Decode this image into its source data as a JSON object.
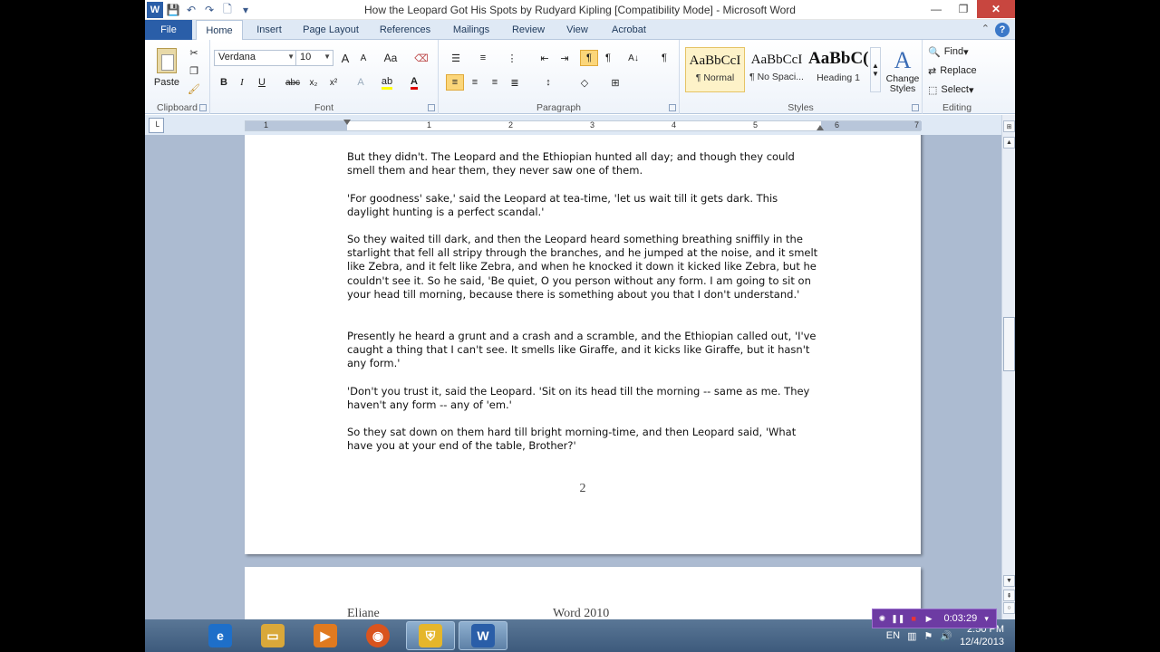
{
  "window": {
    "title": "How the Leopard Got His Spots by Rudyard Kipling [Compatibility Mode]  -  Microsoft Word",
    "controls": {
      "minimize": "—",
      "maximize": "❐",
      "close": "✕"
    }
  },
  "quick_access": {
    "word_icon": "W",
    "save": "💾",
    "undo": "↶",
    "redo": "↷",
    "new": "🗋",
    "customize": "▾"
  },
  "tabs": [
    {
      "label": "File"
    },
    {
      "label": "Home"
    },
    {
      "label": "Insert"
    },
    {
      "label": "Page Layout"
    },
    {
      "label": "References"
    },
    {
      "label": "Mailings"
    },
    {
      "label": "Review"
    },
    {
      "label": "View"
    },
    {
      "label": "Acrobat"
    }
  ],
  "ribbon": {
    "clipboard": {
      "label": "Clipboard",
      "paste": "Paste"
    },
    "font": {
      "label": "Font",
      "family": "Verdana",
      "size": "10",
      "grow": "A",
      "shrink": "A",
      "case": "Aa",
      "bold": "B",
      "italic": "I",
      "underline": "U",
      "strike": "abc",
      "subscript": "x₂",
      "superscript": "x²"
    },
    "paragraph": {
      "label": "Paragraph"
    },
    "styles": {
      "label": "Styles",
      "items": [
        {
          "sample": "AaBbCcI",
          "name": "¶ Normal"
        },
        {
          "sample": "AaBbCcI",
          "name": "¶ No Spaci..."
        },
        {
          "sample": "AaBbC(",
          "name": "Heading 1"
        }
      ],
      "change_styles": "Change Styles"
    },
    "editing": {
      "label": "Editing",
      "find": "Find",
      "replace": "Replace",
      "select": "Select"
    }
  },
  "ruler": {
    "numbers": [
      "1",
      "1",
      "2",
      "3",
      "4",
      "5",
      "6",
      "7"
    ]
  },
  "document": {
    "paragraphs": [
      "But they didn't. The Leopard and the Ethiopian  hunted  all day; and though they could smell them and hear them, they never saw one of them.",
      "'For goodness' sake,' said the Leopard at tea-time, 'let us wait till it gets dark. This daylight  hunting  is a perfect scandal.'",
      "So they waited till dark, and then the Leopard heard something breathing  sniffily in the starlight that fell all stripy through the branches, and he jumped at the noise, and it smelt like Zebra, and it felt like Zebra, and when he knocked it down it kicked like Zebra, but he couldn't see it. So he said, 'Be quiet,  O you person without  any form. I am going to sit on your head till morning, because there is something  about you that I don't understand.'",
      "Presently he heard a grunt and a crash and a scramble, and the Ethiopian  called out, 'I've caught  a thing that I can't see. It smells like Giraffe, and it kicks like Giraffe, but it hasn't any form.'",
      "'Don't you trust it, said the Leopard. 'Sit on its head till the morning -- same as me. They haven't any form -- any of 'em.'",
      "So they sat down on them hard till bright morning-time,  and then Leopard said, 'What have you at your end of the table, Brother?'"
    ],
    "page_number": "2",
    "next_page_header_left": "Eliane",
    "next_page_header_center": "Word 2010"
  },
  "taskbar": {
    "apps": [
      {
        "name": "Internet Explorer",
        "glyph": "e",
        "color": "#1e6fc9"
      },
      {
        "name": "Windows Explorer",
        "glyph": "▭",
        "color": "#d9a83a"
      },
      {
        "name": "Media Player",
        "glyph": "▶",
        "color": "#e07a1f"
      },
      {
        "name": "Firefox",
        "glyph": "◉",
        "color": "#d9541e"
      },
      {
        "name": "Security",
        "glyph": "⛨",
        "color": "#e5b62b"
      },
      {
        "name": "Word",
        "glyph": "W",
        "color": "#2a5ea8"
      }
    ],
    "language": "EN",
    "time": "2:50 PM",
    "date": "12/4/2013"
  },
  "recorder": {
    "time": "0:03:29"
  }
}
